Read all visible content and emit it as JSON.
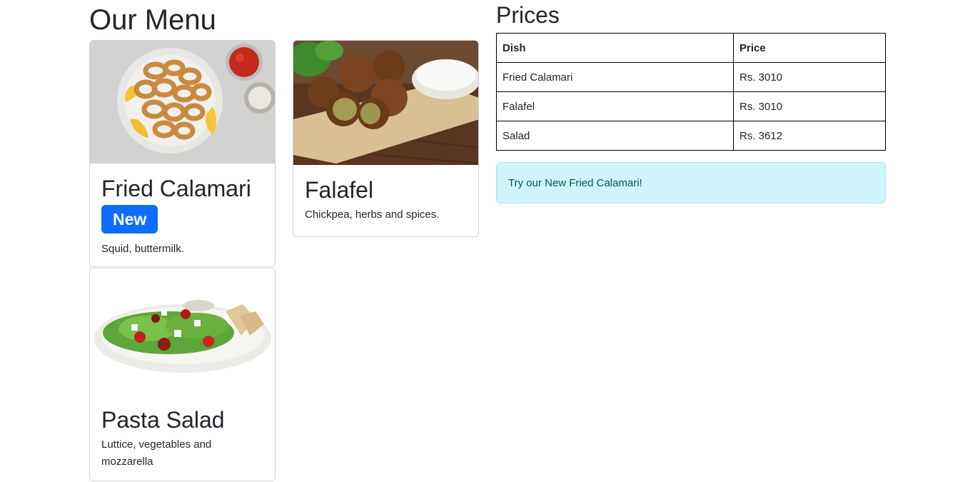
{
  "menu": {
    "title": "Our Menu",
    "cards": [
      {
        "title": "Fried Calamari",
        "badge": "New",
        "description": "Squid, buttermilk."
      },
      {
        "title": "Falafel",
        "description": "Chickpea, herbs and spices."
      },
      {
        "title": "Pasta Salad",
        "description": "Luttice, vegetables and mozzarella"
      }
    ]
  },
  "prices": {
    "title": "Prices",
    "headers": [
      "Dish",
      "Price"
    ],
    "rows": [
      [
        "Fried Calamari",
        "Rs. 3010"
      ],
      [
        "Falafel",
        "Rs. 3010"
      ],
      [
        "Salad",
        "Rs. 3612"
      ]
    ]
  },
  "alert": {
    "text": "Try our New Fried Calamari!"
  },
  "colors": {
    "badge": "#0d6efd",
    "alert_bg": "#cff4fc",
    "alert_text": "#055160",
    "text": "#212529"
  }
}
